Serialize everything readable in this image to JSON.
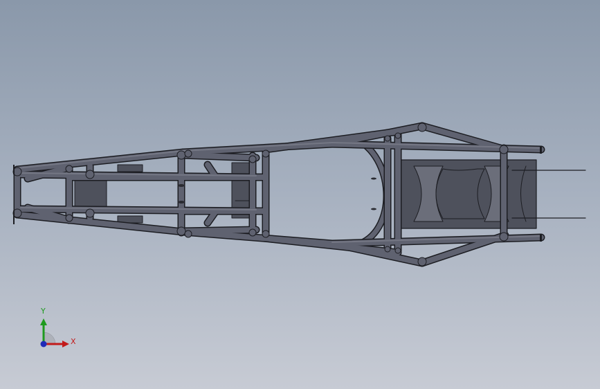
{
  "viewport": {
    "background_top": "#8a98aa",
    "background_bottom": "#c7cbd4",
    "model": "tube-frame-chassis",
    "view": "top"
  },
  "triad": {
    "x_label": "X",
    "y_label": "Y",
    "x_color": "#c21a1a",
    "y_color": "#1e9a1e",
    "z_color": "#1f2bb8"
  },
  "colors": {
    "tube": "#5f6270",
    "tube_edge": "#1c1d22",
    "plate": "#4e515c",
    "plate_light": "#6b6e7a"
  }
}
